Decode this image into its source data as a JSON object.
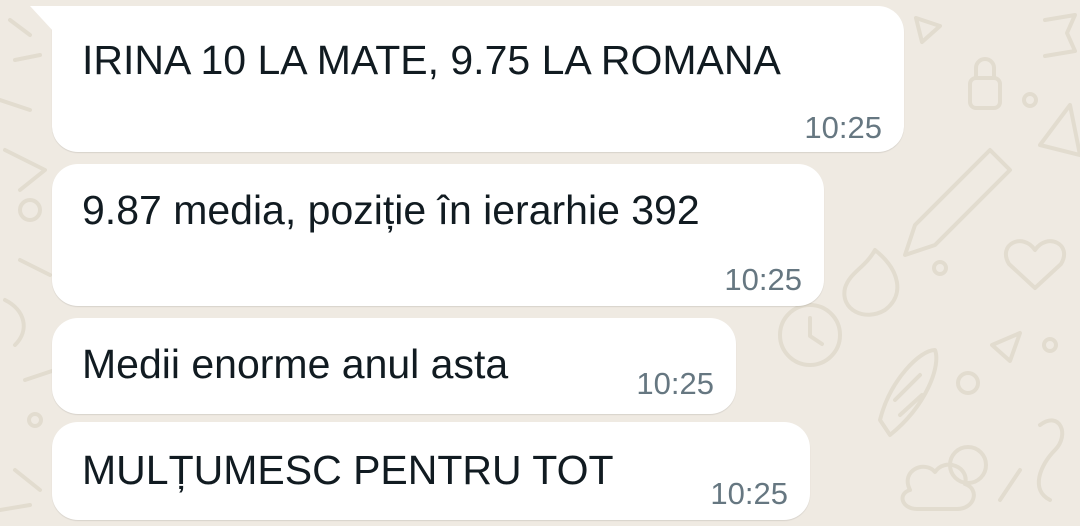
{
  "chat": {
    "messages": [
      {
        "text": "IRINA 10 LA MATE, 9.75 LA ROMANA",
        "time": "10:25"
      },
      {
        "text": "9.87 media, poziție în ierarhie 392",
        "time": "10:25"
      },
      {
        "text": "Medii enorme anul asta",
        "time": "10:25"
      },
      {
        "text": "MULȚUMESC PENTRU TOT",
        "time": "10:25"
      }
    ]
  },
  "colors": {
    "background": "#efeae2",
    "bubble": "#ffffff",
    "text": "#111b21",
    "timestamp": "#667781"
  }
}
